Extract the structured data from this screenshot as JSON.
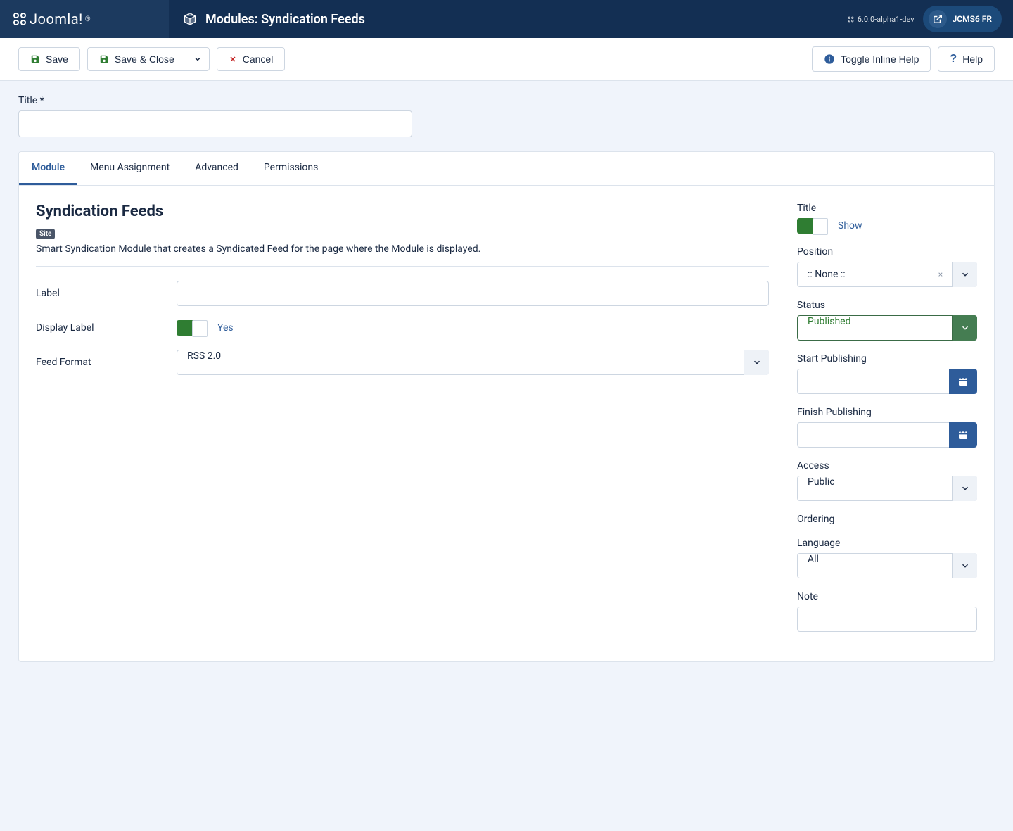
{
  "brand": "Joomla!",
  "page_title": "Modules: Syndication Feeds",
  "version_text": "6.0.0-alpha1-dev",
  "user_label": "JCMS6 FR",
  "toolbar": {
    "save": "Save",
    "save_close": "Save & Close",
    "cancel": "Cancel",
    "toggle_help": "Toggle Inline Help",
    "help": "Help"
  },
  "title_field": {
    "label": "Title *",
    "value": ""
  },
  "tabs": [
    "Module",
    "Menu Assignment",
    "Advanced",
    "Permissions"
  ],
  "module": {
    "heading": "Syndication Feeds",
    "badge": "Site",
    "description": "Smart Syndication Module that creates a Syndicated Feed for the page where the Module is displayed.",
    "label_field": {
      "label": "Label",
      "value": ""
    },
    "display_label": {
      "label": "Display Label",
      "state_text": "Yes"
    },
    "feed_format": {
      "label": "Feed Format",
      "value": "RSS 2.0"
    }
  },
  "sidebar": {
    "title": {
      "label": "Title",
      "state_text": "Show"
    },
    "position": {
      "label": "Position",
      "value": ":: None ::"
    },
    "status": {
      "label": "Status",
      "value": "Published"
    },
    "start_publishing": {
      "label": "Start Publishing",
      "value": ""
    },
    "finish_publishing": {
      "label": "Finish Publishing",
      "value": ""
    },
    "access": {
      "label": "Access",
      "value": "Public"
    },
    "ordering": {
      "label": "Ordering"
    },
    "language": {
      "label": "Language",
      "value": "All"
    },
    "note": {
      "label": "Note",
      "value": ""
    }
  }
}
